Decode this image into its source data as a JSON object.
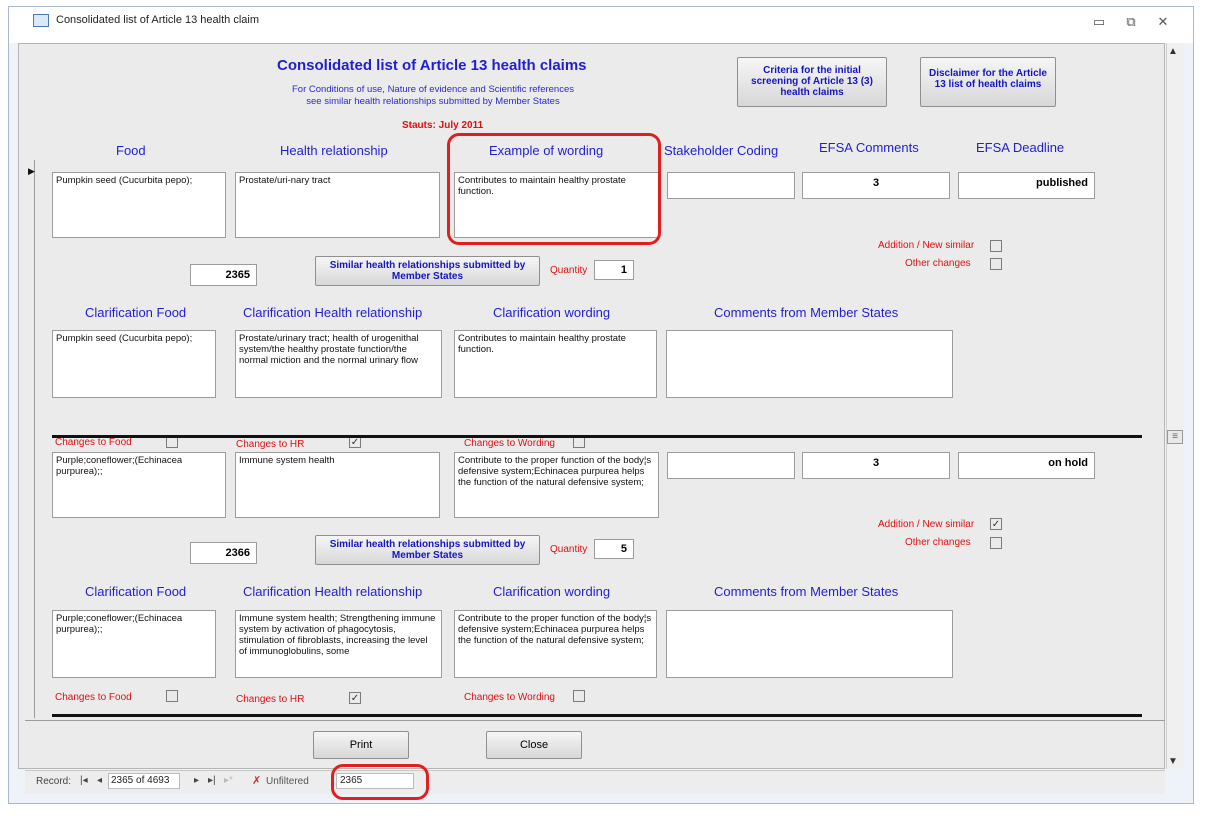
{
  "window": {
    "title": "Consolidated list of Article 13 health claim",
    "minimize": "▭",
    "restore": "⧉",
    "close": "✕"
  },
  "header": {
    "title": "Consolidated list of Article 13 health claims",
    "subtitle1": "For Conditions of use, Nature of evidence and Scientific references",
    "subtitle2": "see similar health relationships submitted by Member States",
    "status": "Stauts: July 2011",
    "criteria_button": "Criteria for the initial screening of Article 13 (3) health claims",
    "disclaimer_button": "Disclaimer for the Article 13 list of health claims"
  },
  "columns": {
    "food": "Food",
    "health_relationship": "Health relationship",
    "example": "Example of wording",
    "stakeholder": "Stakeholder Coding",
    "efsa_comments": "EFSA Comments",
    "efsa_deadline": "EFSA Deadline"
  },
  "labels": {
    "addition": "Addition / New similar",
    "other": "Other changes",
    "similar_button": "Similar health relationships submitted by Member States",
    "quantity": "Quantity",
    "clar_food": "Clarification Food",
    "clar_hr": "Clarification Health relationship",
    "clar_wording": "Clarification wording",
    "comments_ms": "Comments from Member States",
    "changes_food": "Changes to Food",
    "changes_hr": "Changes to HR",
    "changes_wording": "Changes to Wording"
  },
  "records": [
    {
      "food": "Pumpkin seed (Cucurbita pepo);",
      "health_relationship": "Prostate/uri-nary tract",
      "example": "Contributes to maintain healthy prostate function.",
      "stakeholder": "",
      "efsa_comments": "3",
      "efsa_deadline": "published",
      "id": "2365",
      "quantity": "1",
      "addition_checked": "",
      "other_checked": "",
      "clar_food": "Pumpkin seed (Cucurbita pepo);",
      "clar_hr": "Prostate/urinary tract; health of urogenithal system/the healthy prostate function/the normal miction and the normal urinary flow",
      "clar_wording": "Contributes to maintain healthy prostate function.",
      "comments_ms": "",
      "changes_food_checked": "",
      "changes_hr_checked": "✓",
      "changes_wording_checked": ""
    },
    {
      "food": "Purple;coneflower;(Echinacea purpurea);;",
      "health_relationship": "Immune system health",
      "example": "Contribute to the proper function of the body¦s defensive system;Echinacea purpurea helps the function of the natural defensive system;",
      "stakeholder": "",
      "efsa_comments": "3",
      "efsa_deadline": "on hold",
      "id": "2366",
      "quantity": "5",
      "addition_checked": "✓",
      "other_checked": "",
      "clar_food": "Purple;coneflower;(Echinacea purpurea);;",
      "clar_hr": "Immune system health; Strengthening immune system by activation of phagocytosis, stimulation of fibroblasts, increasing the level of immunoglobulins, some",
      "clar_wording": "Contribute to the proper function of the body¦s defensive system;Echinacea purpurea helps the function of the natural defensive system;",
      "comments_ms": "",
      "changes_food_checked": "",
      "changes_hr_checked": "✓",
      "changes_wording_checked": ""
    }
  ],
  "footer": {
    "print": "Print",
    "close": "Close"
  },
  "nav": {
    "record_label": "Record:",
    "first": "|◂",
    "prev": "◂",
    "position": "2365 of 4693",
    "next": "▸",
    "last": "▸|",
    "new": "▸*",
    "filter": "Unfiltered",
    "search_value": "2365"
  },
  "scrollbar": {
    "up": "▲",
    "down": "▼",
    "thumb": "≡"
  },
  "colors": {
    "blue_text": "#1f1fcf",
    "red_text": "#e01010",
    "callout": "#e02020"
  }
}
